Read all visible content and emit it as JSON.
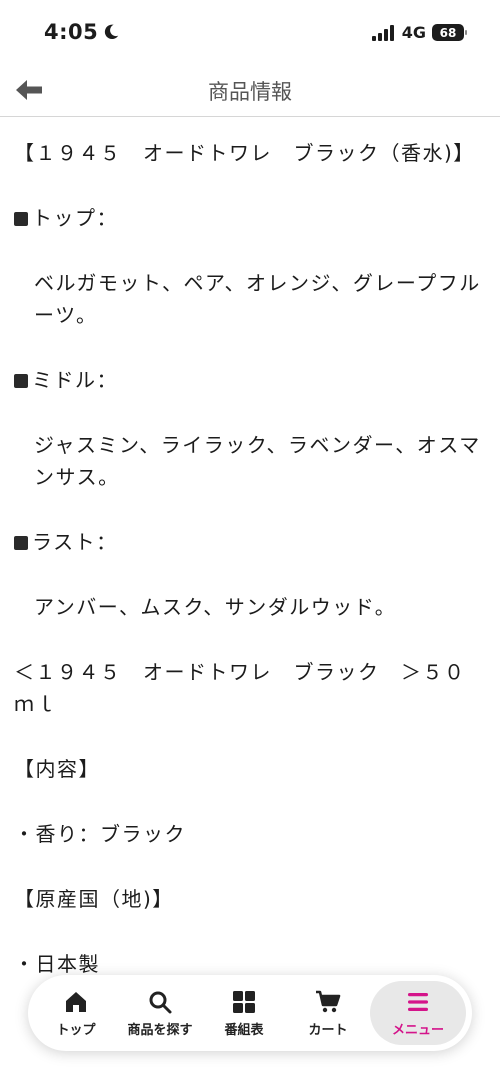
{
  "status_bar": {
    "time": "4:05",
    "network": "4G",
    "battery": "68"
  },
  "header": {
    "title": "商品情報"
  },
  "content": {
    "paragraphs": [
      {
        "text": "【１９４５　オードトワレ　ブラック（香水)】",
        "indent": false,
        "square": false
      },
      {
        "text": "トップ：",
        "indent": false,
        "square": true
      },
      {
        "text": "ベルガモット、ペア、オレンジ、グレープフルーツ。",
        "indent": true,
        "square": false
      },
      {
        "text": "ミドル：",
        "indent": false,
        "square": true
      },
      {
        "text": "ジャスミン、ライラック、ラベンダー、オスマンサス。",
        "indent": true,
        "square": false
      },
      {
        "text": "ラスト：",
        "indent": false,
        "square": true
      },
      {
        "text": "アンバー、ムスク、サンダルウッド。",
        "indent": true,
        "square": false
      },
      {
        "text": "＜１９４５　オードトワレ　ブラック　＞５０ｍｌ",
        "indent": false,
        "square": false
      },
      {
        "text": "【内容】",
        "indent": false,
        "square": false
      },
      {
        "text": "・香り：ブラック",
        "indent": false,
        "square": false
      },
      {
        "text": "【原産国（地)】",
        "indent": false,
        "square": false
      },
      {
        "text": "・日本製",
        "indent": false,
        "square": false
      }
    ]
  },
  "bottom_nav": {
    "items": [
      {
        "label": "トップ",
        "icon": "home-icon"
      },
      {
        "label": "商品を探す",
        "icon": "search-icon"
      },
      {
        "label": "番組表",
        "icon": "grid-icon"
      },
      {
        "label": "カート",
        "icon": "cart-icon"
      },
      {
        "label": "メニュー",
        "icon": "menu-icon"
      }
    ],
    "active_index": 4,
    "accent_color": "#d4148a"
  }
}
